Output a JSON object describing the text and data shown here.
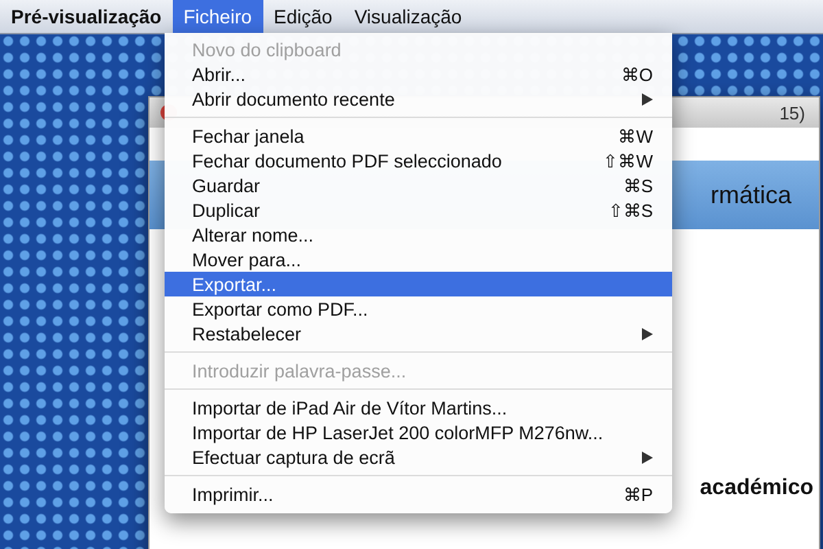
{
  "menu_bar": {
    "app": "Pré-visualização",
    "menus": [
      {
        "label": "Ficheiro",
        "selected": true
      },
      {
        "label": "Edição",
        "selected": false
      },
      {
        "label": "Visualização",
        "selected": false
      }
    ]
  },
  "background_window": {
    "title": "15)",
    "heading": "rmática",
    "body": "académico"
  },
  "menu": {
    "items": [
      {
        "kind": "item",
        "label": "Novo do clipboard",
        "disabled": true,
        "selected": false
      },
      {
        "kind": "item",
        "label": "Abrir...",
        "shortcut": "⌘O",
        "disabled": false,
        "selected": false
      },
      {
        "kind": "item",
        "label": "Abrir documento recente",
        "submenu": true,
        "disabled": false,
        "selected": false
      },
      {
        "kind": "separator"
      },
      {
        "kind": "item",
        "label": "Fechar janela",
        "shortcut": "⌘W",
        "disabled": false,
        "selected": false
      },
      {
        "kind": "item",
        "label": "Fechar documento PDF seleccionado",
        "shortcut": "⇧⌘W",
        "disabled": false,
        "selected": false
      },
      {
        "kind": "item",
        "label": "Guardar",
        "shortcut": "⌘S",
        "disabled": false,
        "selected": false
      },
      {
        "kind": "item",
        "label": "Duplicar",
        "shortcut": "⇧⌘S",
        "disabled": false,
        "selected": false
      },
      {
        "kind": "item",
        "label": "Alterar nome...",
        "disabled": false,
        "selected": false
      },
      {
        "kind": "item",
        "label": "Mover para...",
        "disabled": false,
        "selected": false
      },
      {
        "kind": "item",
        "label": "Exportar...",
        "disabled": false,
        "selected": true
      },
      {
        "kind": "item",
        "label": "Exportar como PDF...",
        "disabled": false,
        "selected": false
      },
      {
        "kind": "item",
        "label": "Restabelecer",
        "submenu": true,
        "disabled": false,
        "selected": false
      },
      {
        "kind": "separator"
      },
      {
        "kind": "item",
        "label": "Introduzir palavra-passe...",
        "disabled": true,
        "selected": false
      },
      {
        "kind": "separator"
      },
      {
        "kind": "item",
        "label": "Importar de iPad Air de Vítor Martins...",
        "disabled": false,
        "selected": false
      },
      {
        "kind": "item",
        "label": "Importar de HP LaserJet 200 colorMFP M276nw...",
        "disabled": false,
        "selected": false
      },
      {
        "kind": "item",
        "label": "Efectuar captura de ecrã",
        "submenu": true,
        "disabled": false,
        "selected": false
      },
      {
        "kind": "separator"
      },
      {
        "kind": "item",
        "label": "Imprimir...",
        "shortcut": "⌘P",
        "disabled": false,
        "selected": false
      }
    ]
  }
}
